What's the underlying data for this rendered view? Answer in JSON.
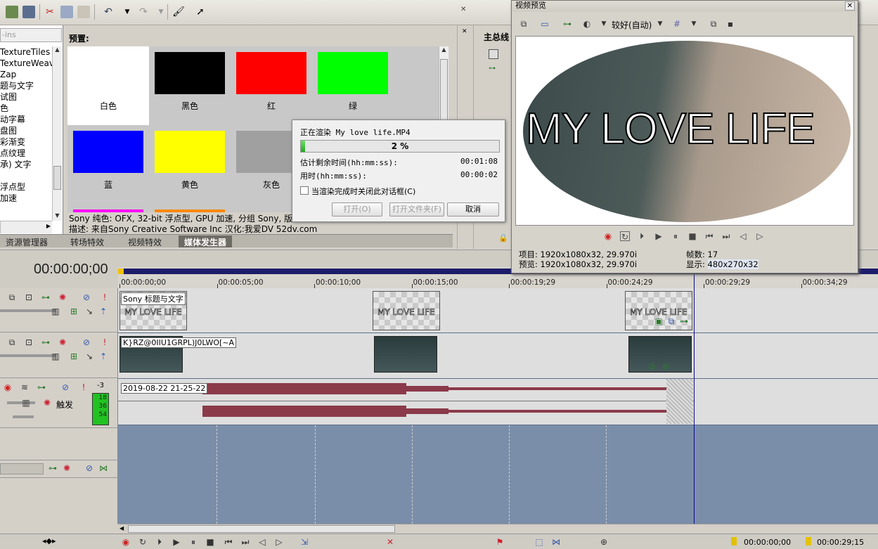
{
  "plugin_list": {
    "search_placeholder": "-ins",
    "items": [
      "TextureTiles",
      "TextureWeav",
      "Zap",
      "题与文字",
      "试图",
      "色",
      "动字幕",
      "盘图",
      "彩渐变",
      "点纹理",
      "承) 文字",
      "",
      "浮点型",
      "加速"
    ]
  },
  "presets": {
    "label": "预置:",
    "swatches": [
      {
        "name": "白色",
        "color": "#ffffff"
      },
      {
        "name": "黑色",
        "color": "#000000"
      },
      {
        "name": "红",
        "color": "#ff0000"
      },
      {
        "name": "绿",
        "color": "#00ff00"
      },
      {
        "name": "蓝",
        "color": "#0000ff"
      },
      {
        "name": "黄色",
        "color": "#ffff00"
      },
      {
        "name": "灰色",
        "color": "#a0a0a0"
      }
    ],
    "desc_line1": "Sony 纯色: OFX, 32-bit 浮点型, GPU 加速, 分组 Sony, 版本",
    "desc_line2": "描述: 来自Sony Creative Software Inc 汉化:我爱DV 52dv.com"
  },
  "tabs": [
    "资源管理器",
    "转场特效",
    "视频特效",
    "媒体发生器"
  ],
  "render_dialog": {
    "title_line": "正在渲染 My love life.MP4",
    "progress_percent": 2,
    "progress_text": "2 %",
    "remaining_label": "估计剩余时间(hh:mm:ss):",
    "remaining_value": "00:01:08",
    "elapsed_label": "用时(hh:mm:ss):",
    "elapsed_value": "00:00:02",
    "close_checkbox_label": "当渲染完成时关闭此对话框(C)",
    "btn_open": "打开(O)",
    "btn_open_folder": "打开文件夹(F)",
    "btn_cancel": "取消"
  },
  "master_bus": {
    "label": "主总线"
  },
  "preview": {
    "title": "视频预览",
    "quality": "较好(自动)",
    "video_text": "MY LOVE LIFE",
    "project_label": "项目:",
    "project_value": "1920x1080x32, 29.970i",
    "preview_label": "预览:",
    "preview_value": "1920x1080x32, 29.970i",
    "frame_label": "帧数:",
    "frame_value": "17",
    "display_label": "显示:",
    "display_value": "480x270x32"
  },
  "timeline": {
    "timecode": "00:00:00;00",
    "ruler": [
      "00:00:00;00",
      "00:00:05;00",
      "00:00:10;00",
      "00:00:15;00",
      "00:00:19;29",
      "00:00:24;29",
      "00:00:29;29",
      "00:00:34;29"
    ],
    "title_clip_label": "Sony 标题与文字",
    "title_overlay_text": "MY LOVE LIFE",
    "video_clip_label": "K}RZ@0IIU1GRPL)J0LWO[~A",
    "audio_clip_label": "2019-08-22 21-25-22",
    "audio_trigger": "触发",
    "audio_level": "-3",
    "meter_values": [
      "18",
      "36",
      "54"
    ]
  },
  "bottom": {
    "time_left": "00:00:00;00",
    "time_right": "00:00:29;15"
  },
  "colors": {
    "accent": "#1c1c6a",
    "waveform": "#8b3a4a",
    "track": "#7b8ea9"
  }
}
